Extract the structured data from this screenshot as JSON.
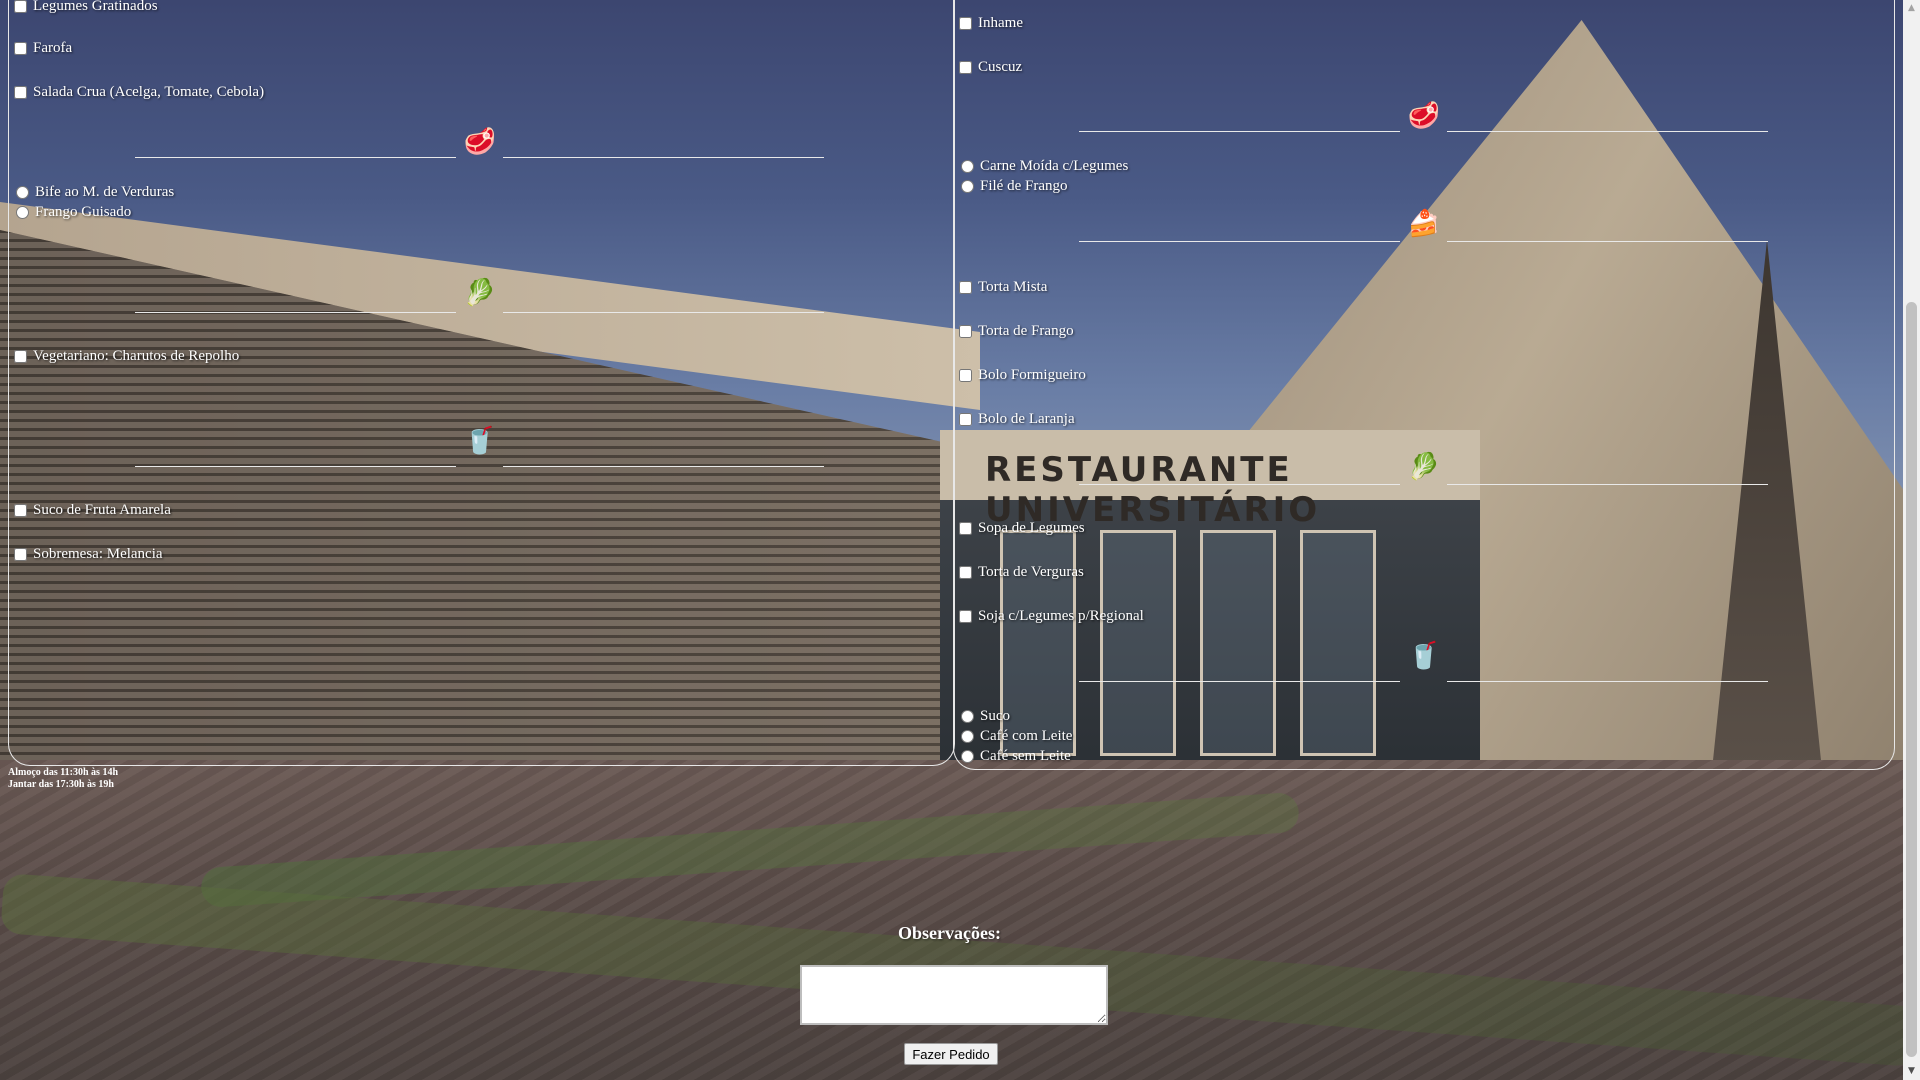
{
  "left_column": {
    "items": [
      {
        "type": "checkbox",
        "label": "Legumes Gratinados"
      },
      {
        "type": "checkbox",
        "label": "Farofa"
      },
      {
        "type": "checkbox",
        "label": "Salada Crua (Acelga, Tomate, Cebola)"
      },
      {
        "type": "radio",
        "label": "Bife ao M. de Verduras"
      },
      {
        "type": "radio",
        "label": "Frango Guisado"
      },
      {
        "type": "checkbox",
        "label": "Vegetariano: Charutos de Repolho"
      },
      {
        "type": "checkbox",
        "label": "Suco de Fruta Amarela"
      },
      {
        "type": "checkbox",
        "label": "Sobremesa: Melancia"
      }
    ],
    "dividers": [
      {
        "icon": "meat-icon",
        "glyph": "🥩"
      },
      {
        "icon": "cabbage-icon",
        "glyph": "🥬"
      },
      {
        "icon": "juice-cup-icon",
        "glyph": "🥤"
      }
    ]
  },
  "right_column": {
    "items": [
      {
        "type": "checkbox",
        "label": "Inhame"
      },
      {
        "type": "checkbox",
        "label": "Cuscuz"
      },
      {
        "type": "radio",
        "label": "Carne Moída c/Legumes"
      },
      {
        "type": "radio",
        "label": "Filé de Frango"
      },
      {
        "type": "checkbox",
        "label": "Torta Mista"
      },
      {
        "type": "checkbox",
        "label": "Torta de Frango"
      },
      {
        "type": "checkbox",
        "label": "Bolo Formigueiro"
      },
      {
        "type": "checkbox",
        "label": "Bolo de Laranja"
      },
      {
        "type": "checkbox",
        "label": "Sopa de Legumes"
      },
      {
        "type": "checkbox",
        "label": "Torta de Verguras"
      },
      {
        "type": "checkbox",
        "label": "Soja c/Legumes p/Regional"
      },
      {
        "type": "radio",
        "label": "Suco"
      },
      {
        "type": "radio",
        "label": "Café com Leite"
      },
      {
        "type": "radio",
        "label": "Café sem Leite"
      }
    ],
    "dividers": [
      {
        "icon": "meat-icon",
        "glyph": "🥩"
      },
      {
        "icon": "cake-slice-icon",
        "glyph": "🍰"
      },
      {
        "icon": "cabbage-icon",
        "glyph": "🥬"
      },
      {
        "icon": "juice-cup-icon",
        "glyph": "🥤"
      }
    ]
  },
  "hours": {
    "lunch": "Almoço das 11:30h às 14h",
    "dinner": "Jantar das 17:30h às 19h"
  },
  "background": {
    "sign_text": "RESTAURANTE UNIVERSITÁRIO"
  },
  "form": {
    "observations_label": "Observações:",
    "observations_value": "",
    "submit_label": "Fazer Pedido"
  },
  "colors": {
    "panel_border": "#e8e8e8",
    "text": "#ffffff"
  }
}
